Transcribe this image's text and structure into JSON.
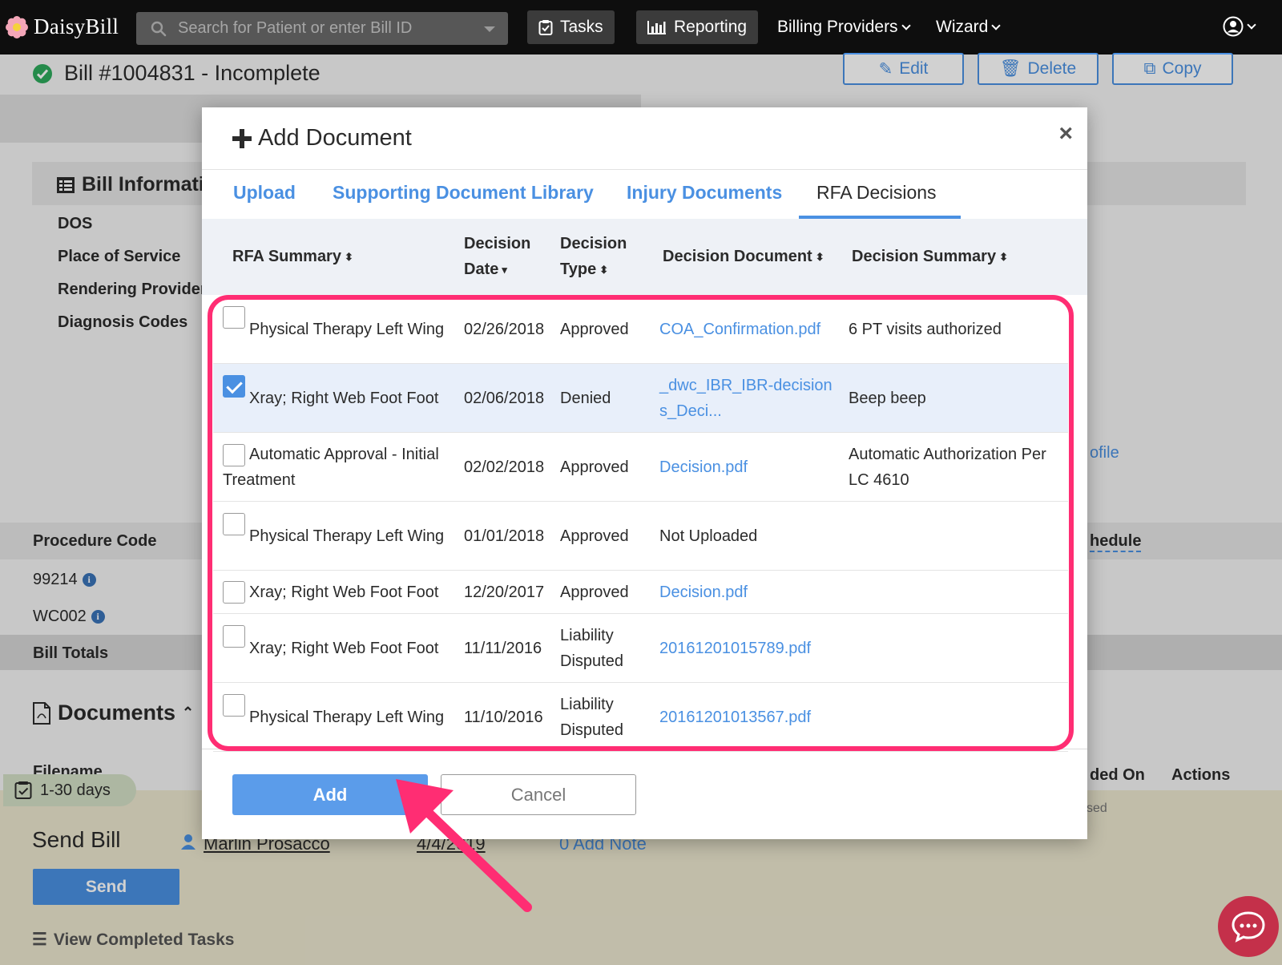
{
  "nav": {
    "brand": "DaisyBill",
    "search_placeholder": "Search for Patient or enter Bill ID",
    "tasks": "Tasks",
    "reporting": "Reporting",
    "billing_providers": "Billing Providers",
    "wizard": "Wizard"
  },
  "bill": {
    "title": "Bill #1004831 - Incomplete",
    "edit": "Edit",
    "delete": "Delete",
    "copy": "Copy",
    "info_heading": "Bill Informati",
    "info_labels": [
      "DOS",
      "Place of Service",
      "Rendering Provider",
      "Diagnosis Codes"
    ],
    "procedure_heading": "Procedure Code",
    "procedure_codes": [
      "99214",
      "WC002"
    ],
    "totals": "Bill Totals",
    "documents_heading": "Documents",
    "filename_col": "Filename",
    "uploaded_on_col": "ded On",
    "actions_col": "Actions",
    "profile_peek": "ofile",
    "schedule_peek": "hedule",
    "used_peek": "sed"
  },
  "tasks": {
    "days_chip": "1-30 days",
    "send_title": "Send Bill",
    "send_button": "Send",
    "assignee": "Marlin Prosacco",
    "date": "4/4/2019",
    "add_note": "0 Add Note",
    "view_completed": "View Completed Tasks"
  },
  "modal": {
    "title": "Add Document",
    "close": "×",
    "tabs": [
      "Upload",
      "Supporting Document Library",
      "Injury Documents",
      "RFA Decisions"
    ],
    "active_tab": "RFA Decisions",
    "columns": {
      "rfa_summary": "RFA Summary",
      "decision_date_1": "Decision",
      "decision_date_2": "Date",
      "decision_type_1": "Decision",
      "decision_type_2": "Type",
      "decision_document": "Decision Document",
      "decision_summary": "Decision Summary"
    },
    "rows": [
      {
        "checked": false,
        "summary": "Physical Therapy Left Wing",
        "date": "02/26/2018",
        "type": "Approved",
        "document": "COA_Confirmation.pdf",
        "doc_link": true,
        "decision_summary": "6 PT visits authorized"
      },
      {
        "checked": true,
        "summary": "Xray; Right Web Foot Foot",
        "date": "02/06/2018",
        "type": "Denied",
        "document": "_dwc_IBR_IBR-decisions_Deci...",
        "doc_link": true,
        "decision_summary": "Beep beep"
      },
      {
        "checked": false,
        "summary": "Automatic Approval - Initial Treatment",
        "date": "02/02/2018",
        "type": "Approved",
        "document": "Decision.pdf",
        "doc_link": true,
        "decision_summary": "Automatic Authorization Per LC 4610"
      },
      {
        "checked": false,
        "summary": "Physical Therapy Left Wing",
        "date": "01/01/2018",
        "type": "Approved",
        "document": "Not Uploaded",
        "doc_link": false,
        "decision_summary": ""
      },
      {
        "checked": false,
        "summary": "Xray; Right Web Foot Foot",
        "date": "12/20/2017",
        "type": "Approved",
        "document": "Decision.pdf",
        "doc_link": true,
        "decision_summary": ""
      },
      {
        "checked": false,
        "summary": "Xray; Right Web Foot Foot",
        "date": "11/11/2016",
        "type": "Liability Disputed",
        "document": "20161201015789.pdf",
        "doc_link": true,
        "decision_summary": ""
      },
      {
        "checked": false,
        "summary": "Physical Therapy Left Wing",
        "date": "11/10/2016",
        "type": "Liability Disputed",
        "document": "20161201013567.pdf",
        "doc_link": true,
        "decision_summary": ""
      }
    ],
    "add_button": "Add",
    "cancel_button": "Cancel"
  },
  "colors": {
    "accent": "#4a90e2",
    "highlight": "#ff2d73",
    "nav_bg": "#0e0e0e",
    "success": "#2eaa5c"
  }
}
